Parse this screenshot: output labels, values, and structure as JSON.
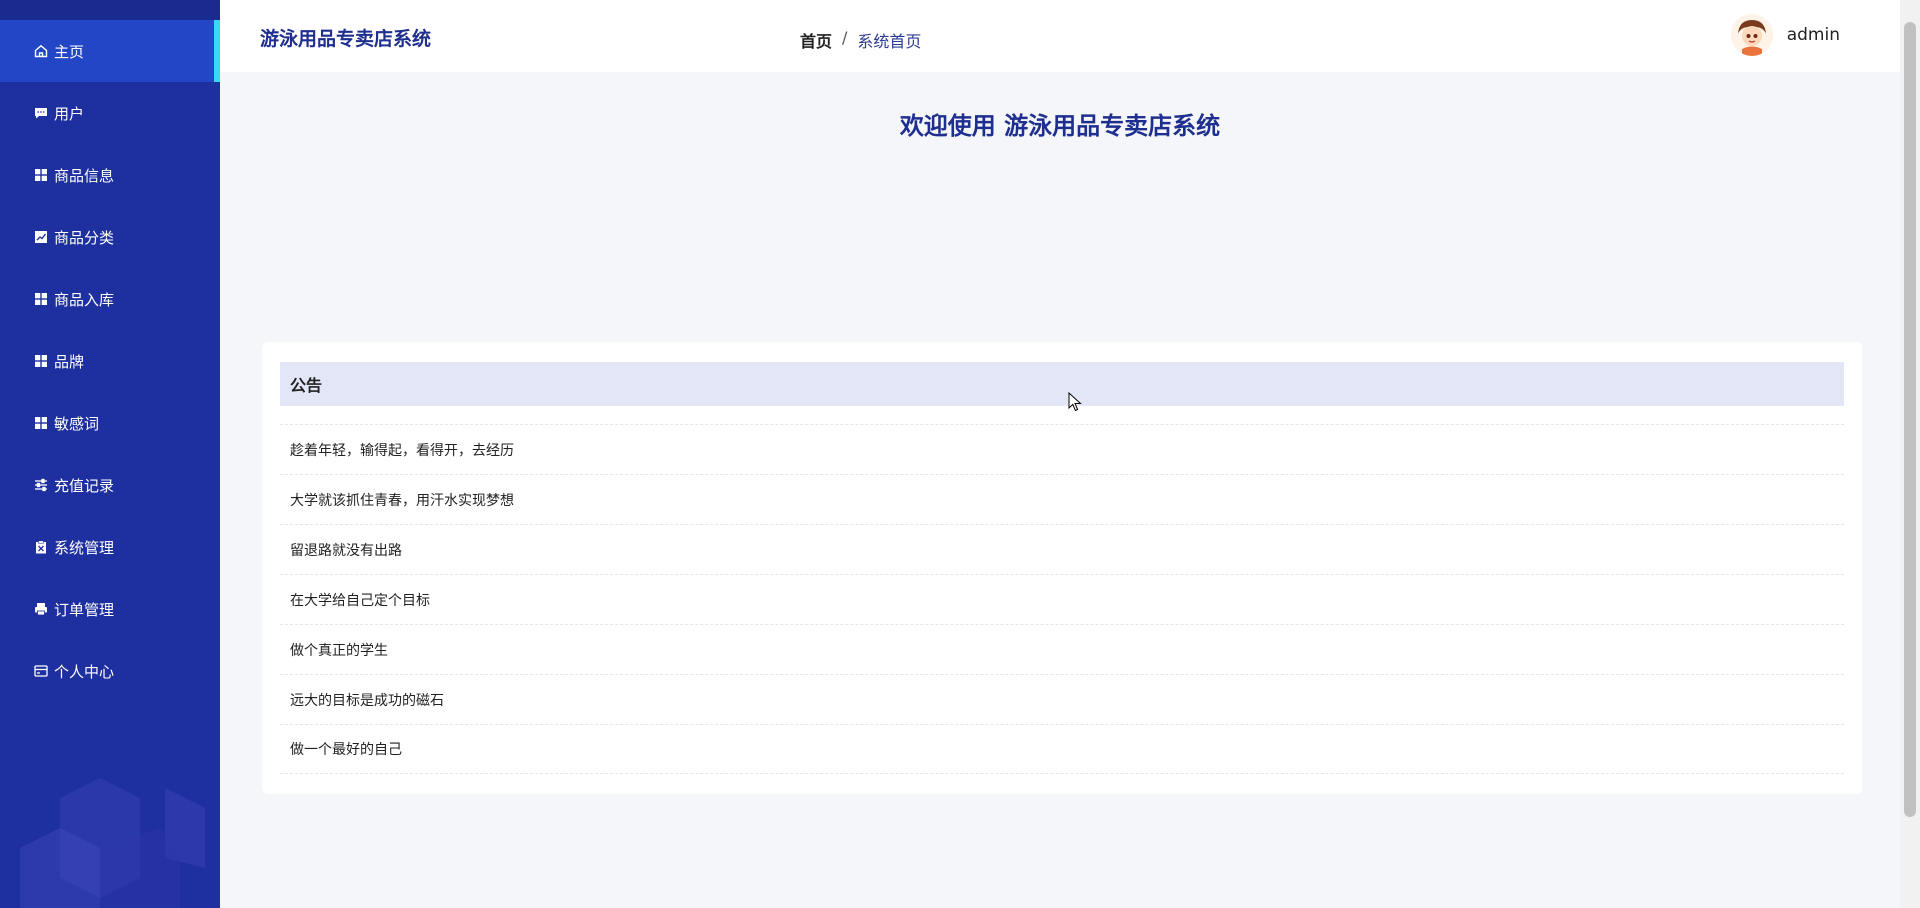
{
  "sidebar": {
    "items": [
      {
        "label": "主页",
        "icon": "home-icon",
        "active": true
      },
      {
        "label": "用户",
        "icon": "chat-icon",
        "active": false
      },
      {
        "label": "商品信息",
        "icon": "grid-icon",
        "active": false
      },
      {
        "label": "商品分类",
        "icon": "chart-icon",
        "active": false
      },
      {
        "label": "商品入库",
        "icon": "grid-icon",
        "active": false
      },
      {
        "label": "品牌",
        "icon": "grid-icon",
        "active": false
      },
      {
        "label": "敏感词",
        "icon": "grid-icon",
        "active": false
      },
      {
        "label": "充值记录",
        "icon": "sliders-icon",
        "active": false
      },
      {
        "label": "系统管理",
        "icon": "clipboard-icon",
        "active": false
      },
      {
        "label": "订单管理",
        "icon": "printer-icon",
        "active": false
      },
      {
        "label": "个人中心",
        "icon": "card-icon",
        "active": false
      }
    ]
  },
  "header": {
    "brand": "游泳用品专卖店系统",
    "breadcrumb": {
      "home": "首页",
      "separator": "/",
      "current": "系统首页"
    },
    "username": "admin"
  },
  "main": {
    "welcome": "欢迎使用 游泳用品专卖店系统",
    "notice": {
      "title": "公告",
      "items": [
        "趁着年轻，输得起，看得开，去经历",
        "大学就该抓住青春，用汗水实现梦想",
        "留退路就没有出路",
        "在大学给自己定个目标",
        "做个真正的学生",
        "远大的目标是成功的磁石",
        "做一个最好的自己"
      ]
    }
  },
  "colors": {
    "sidebar_bg": "#1e2fa0",
    "sidebar_active": "#2346c6",
    "active_indicator": "#38d8f5",
    "brand_text": "#1e2f8f",
    "notice_header_bg": "#e3e6f7"
  }
}
